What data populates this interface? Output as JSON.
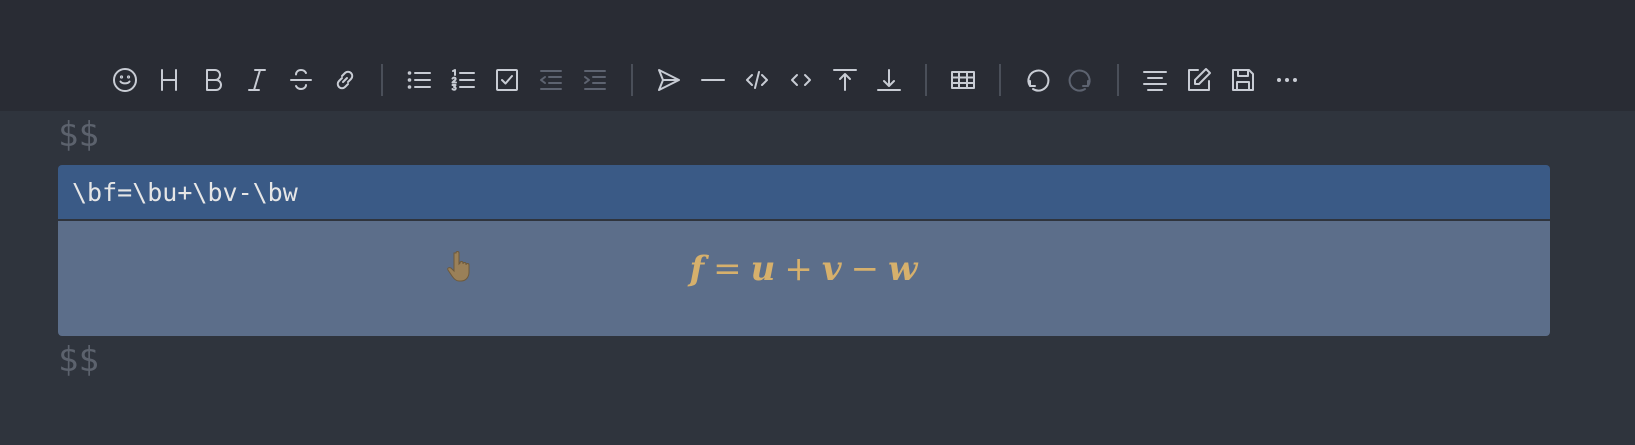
{
  "toolbar": {
    "groups": [
      [
        "emoji-icon",
        "heading-icon",
        "bold-icon",
        "italic-icon",
        "strikethrough-icon",
        "link-icon"
      ],
      [
        "bullet-list-icon",
        "ordered-list-icon",
        "checklist-icon",
        "outdent-icon",
        "indent-icon"
      ],
      [
        "send-icon",
        "horizontal-rule-icon",
        "code-block-icon",
        "inline-code-icon",
        "insert-before-icon",
        "insert-after-icon"
      ],
      [
        "table-icon"
      ],
      [
        "undo-icon",
        "redo-icon"
      ],
      [
        "align-icon",
        "edit-mode-icon",
        "save-icon",
        "more-icon"
      ]
    ],
    "disabled": [
      "redo-icon"
    ]
  },
  "editor": {
    "open_delimiter": "$$",
    "code": "\\bf=\\bu+\\bv-\\bw",
    "close_delimiter": "$$",
    "rendered": {
      "f": "f",
      "eq": "=",
      "u": "u",
      "plus": "+",
      "v": "v",
      "minus": "−",
      "w": "w"
    },
    "math_color": "#d6b06c"
  },
  "colors": {
    "toolbar_bg": "#292c34",
    "editor_bg": "#2f343d",
    "selection": "#3a5a86",
    "preview_bg": "#5c6e8a"
  }
}
